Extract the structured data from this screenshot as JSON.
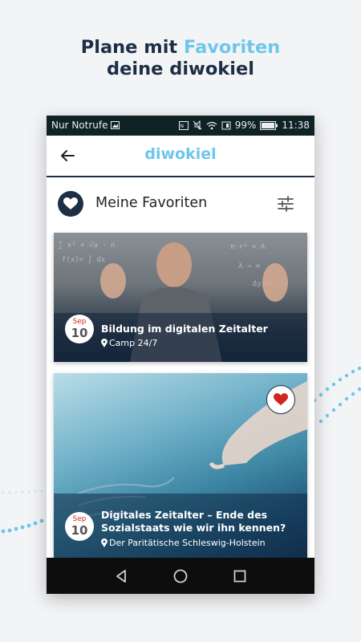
{
  "promo": {
    "line1_part1": "Plane mit ",
    "line1_accent": "Favoriten",
    "line2": "deine diwokiel"
  },
  "status_bar": {
    "carrier": "Nur Notrufe",
    "battery": "99%",
    "time": "11:38"
  },
  "app_bar": {
    "title": "diwokiel",
    "back_icon": "arrow-left-icon"
  },
  "favorites": {
    "title": "Meine Favoriten",
    "filter_icon": "sliders-icon"
  },
  "events": [
    {
      "month": "Sep",
      "day": "10",
      "title": "Bildung im digitalen Zeitalter",
      "location": "Camp 24/7"
    },
    {
      "month": "Sep",
      "day": "10",
      "title_line1": "Digitales Zeitalter – Ende des",
      "title_line2": "Sozialstaats wie wir ihn kennen?",
      "location": "Der Paritätische Schleswig-Holstein",
      "favorited": true
    }
  ],
  "colors": {
    "brand_navy": "#1d2e45",
    "brand_light_blue": "#6ec6ea",
    "heart_red": "#d0261e"
  }
}
